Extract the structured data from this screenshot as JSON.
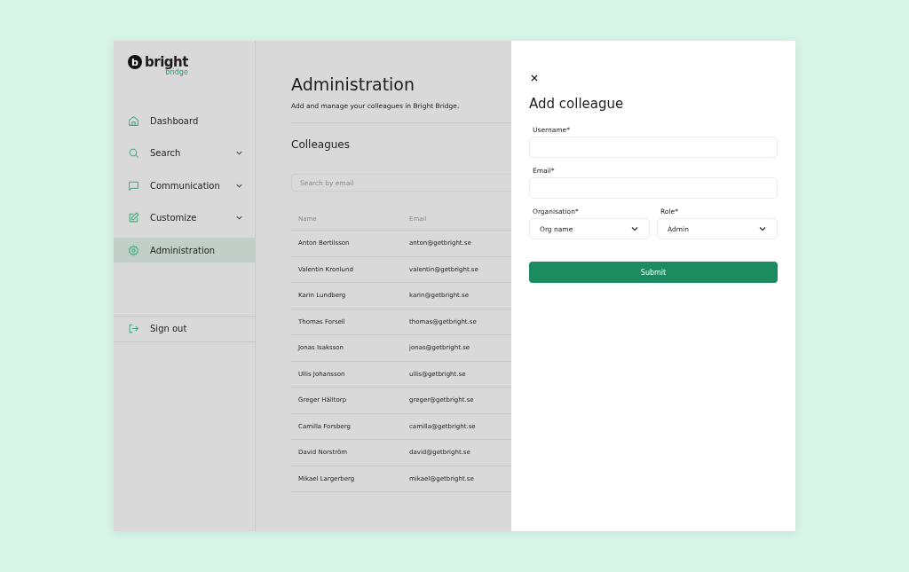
{
  "logo": {
    "mark": "b",
    "name": "bright",
    "subtitle": "bridge"
  },
  "nav": [
    {
      "label": "Dashboard",
      "kind": "home",
      "expandable": false,
      "selected": false
    },
    {
      "label": "Search",
      "kind": "search",
      "expandable": true,
      "selected": false
    },
    {
      "label": "Communication",
      "kind": "chat",
      "expandable": true,
      "selected": false
    },
    {
      "label": "Customize",
      "kind": "edit",
      "expandable": true,
      "selected": false
    },
    {
      "label": "Administration",
      "kind": "gear",
      "expandable": false,
      "selected": true
    }
  ],
  "sign_out": {
    "label": "Sign out"
  },
  "page": {
    "title": "Administration",
    "subtitle": "Add and manage your colleagues in Bright Bridge.",
    "section": "Colleagues",
    "search": {
      "placeholder": "Search by email"
    }
  },
  "table": {
    "columns": [
      "Name",
      "Email"
    ],
    "rows": [
      [
        "Anton Bertilsson",
        "anton@getbright.se"
      ],
      [
        "Valentin Kronlund",
        "valentin@getbright.se"
      ],
      [
        "Karin Lundberg",
        "karin@getbright.se"
      ],
      [
        "Thomas Forsell",
        "thomas@getbright.se"
      ],
      [
        "Jonas Isaksson",
        "jonas@getbright.se"
      ],
      [
        "Ullis Johansson",
        "ullis@getbright.se"
      ],
      [
        "Greger Hälltorp",
        "greger@getbright.se"
      ],
      [
        "Camilla Forsberg",
        "camilla@getbright.se"
      ],
      [
        "David Norström",
        "david@getbright.se"
      ],
      [
        "Mikael Largerberg",
        "mikael@getbright.se"
      ]
    ]
  },
  "panel": {
    "title": "Add colleague",
    "username": {
      "label": "Username*"
    },
    "email": {
      "label": "Email*"
    },
    "organisation": {
      "label": "Organisation*",
      "value": "Org name"
    },
    "role": {
      "label": "Role*",
      "value": "Admin"
    },
    "submit": "Submit"
  }
}
